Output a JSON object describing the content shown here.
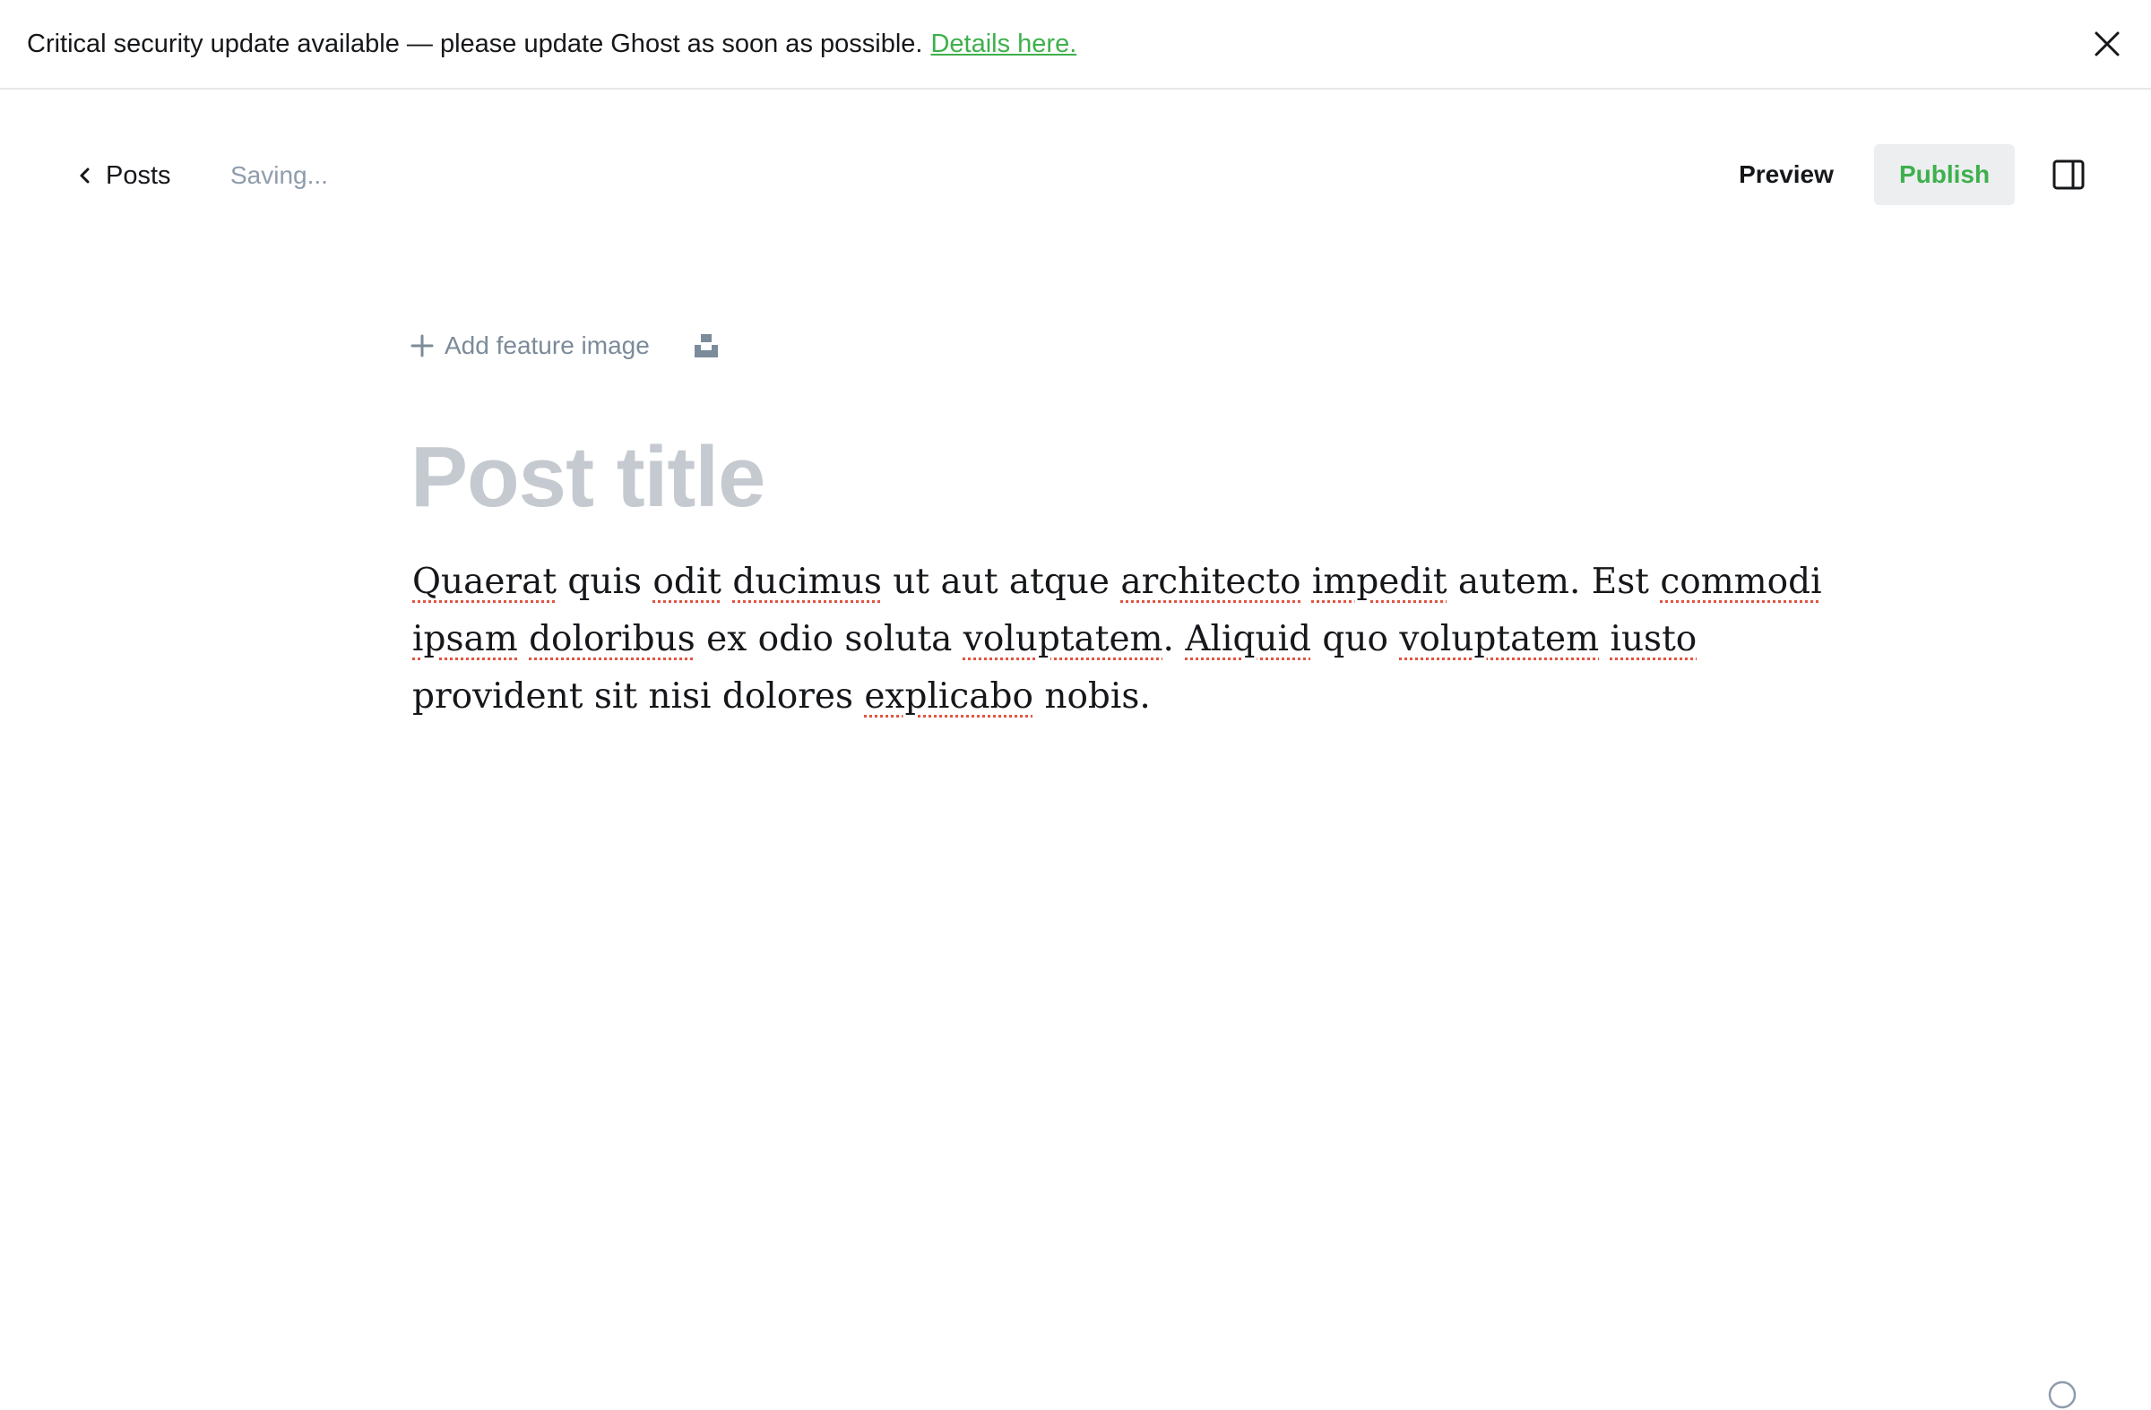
{
  "banner": {
    "message": "Critical security update available — please update Ghost as soon as possible.",
    "link_label": "Details here.",
    "close_icon": "close-icon"
  },
  "header": {
    "back_label": "Posts",
    "back_icon": "chevron-left-icon",
    "status": "Saving...",
    "preview_label": "Preview",
    "publish_label": "Publish",
    "sidebar_icon": "sidebar-toggle-icon"
  },
  "editor": {
    "add_feature_label": "Add feature image",
    "title_placeholder": "Post title",
    "body_lines": [
      [
        {
          "t": "Quaerat",
          "sp": true
        },
        {
          "t": " quis "
        },
        {
          "t": "odit",
          "sp": true
        },
        {
          "t": " "
        },
        {
          "t": "ducimus",
          "sp": true
        },
        {
          "t": " ut aut atque "
        },
        {
          "t": "architecto",
          "sp": true
        },
        {
          "t": " "
        },
        {
          "t": "impedit",
          "sp": true
        },
        {
          "t": " autem. Est "
        },
        {
          "t": "commodi",
          "sp": true
        }
      ],
      [
        {
          "t": "ipsam",
          "sp": true
        },
        {
          "t": " "
        },
        {
          "t": "doloribus",
          "sp": true
        },
        {
          "t": " ex odio soluta "
        },
        {
          "t": "voluptatem",
          "sp": true
        },
        {
          "t": ". "
        },
        {
          "t": "Aliquid",
          "sp": true
        },
        {
          "t": " quo "
        },
        {
          "t": "voluptatem",
          "sp": true
        },
        {
          "t": " "
        },
        {
          "t": "iusto",
          "sp": true
        }
      ],
      [
        {
          "t": "provident sit nisi dolores "
        },
        {
          "t": "explicabo",
          "sp": true
        },
        {
          "t": " nobis."
        }
      ]
    ]
  },
  "colors": {
    "accent_green": "#3eb04c",
    "placeholder": "#c5cad0",
    "spellcheck": "#e25440"
  }
}
